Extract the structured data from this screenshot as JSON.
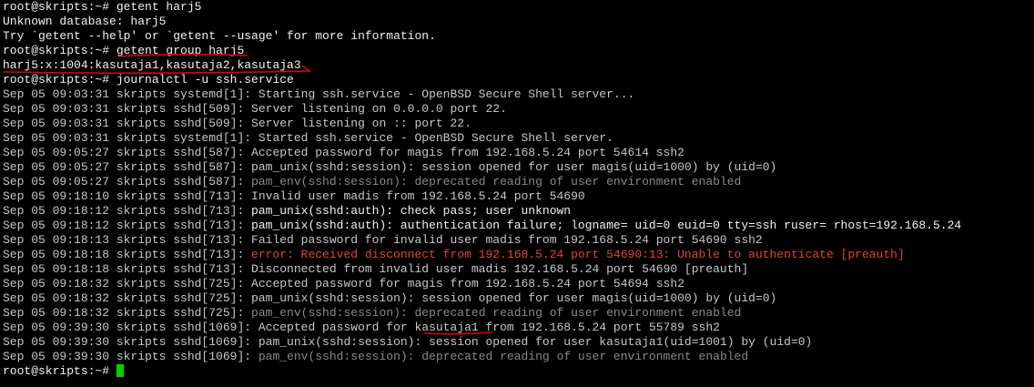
{
  "terminal": {
    "prompt": "root@skripts:~# ",
    "lines": [
      {
        "style": "bright",
        "text": "root@skripts:~# getent harj5"
      },
      {
        "style": "bright",
        "text": "Unknown database: harj5"
      },
      {
        "style": "bright",
        "text": "Try `getent --help' or `getent --usage' for more information."
      },
      {
        "style": "bright",
        "text": "root@skripts:~# getent group harj5"
      },
      {
        "style": "bright",
        "text": "harj5:x:1004:kasutaja1,kasutaja2,kasutaja3"
      },
      {
        "style": "bright",
        "text": "root@skripts:~# journalctl -u ssh.service"
      },
      {
        "style": "normal",
        "text": "Sep 05 09:03:31 skripts systemd[1]: Starting ssh.service - OpenBSD Secure Shell server..."
      },
      {
        "style": "normal",
        "text": "Sep 05 09:03:31 skripts sshd[509]: Server listening on 0.0.0.0 port 22."
      },
      {
        "style": "normal",
        "text": "Sep 05 09:03:31 skripts sshd[509]: Server listening on :: port 22."
      },
      {
        "style": "normal",
        "text": "Sep 05 09:03:31 skripts systemd[1]: Started ssh.service - OpenBSD Secure Shell server."
      },
      {
        "style": "normal",
        "text": "Sep 05 09:05:27 skripts sshd[587]: Accepted password for magis from 192.168.5.24 port 54614 ssh2"
      },
      {
        "style": "normal",
        "text": "Sep 05 09:05:27 skripts sshd[587]: pam_unix(sshd:session): session opened for user magis(uid=1000) by (uid=0)"
      },
      {
        "style": "mixed",
        "prefix": "Sep 05 09:05:27 skripts sshd[587]: ",
        "text": "pam_env(sshd:session): deprecated reading of user environment enabled"
      },
      {
        "style": "normal",
        "text": "Sep 05 09:18:10 skripts sshd[713]: Invalid user madis from 192.168.5.24 port 54690"
      },
      {
        "style": "mixed-bright",
        "prefix": "Sep 05 09:18:12 skripts sshd[713]: ",
        "text": "pam_unix(sshd:auth): check pass; user unknown"
      },
      {
        "style": "mixed-bright",
        "prefix": "Sep 05 09:18:12 skripts sshd[713]: ",
        "text": "pam_unix(sshd:auth): authentication failure; logname= uid=0 euid=0 tty=ssh ruser= rhost=192.168.5.24"
      },
      {
        "style": "normal",
        "text": "Sep 05 09:18:13 skripts sshd[713]: Failed password for invalid user madis from 192.168.5.24 port 54690 ssh2"
      },
      {
        "style": "mixed-err",
        "prefix": "Sep 05 09:18:18 skripts sshd[713]: ",
        "text": "error: Received disconnect from 192.168.5.24 port 54690:13: Unable to authenticate [preauth]"
      },
      {
        "style": "normal",
        "text": "Sep 05 09:18:18 skripts sshd[713]: Disconnected from invalid user madis 192.168.5.24 port 54690 [preauth]"
      },
      {
        "style": "normal",
        "text": "Sep 05 09:18:32 skripts sshd[725]: Accepted password for magis from 192.168.5.24 port 54694 ssh2"
      },
      {
        "style": "normal",
        "text": "Sep 05 09:18:32 skripts sshd[725]: pam_unix(sshd:session): session opened for user magis(uid=1000) by (uid=0)"
      },
      {
        "style": "mixed",
        "prefix": "Sep 05 09:18:32 skripts sshd[725]: ",
        "text": "pam_env(sshd:session): deprecated reading of user environment enabled"
      },
      {
        "style": "normal",
        "text": "Sep 05 09:39:30 skripts sshd[1069]: Accepted password for kasutaja1 from 192.168.5.24 port 55789 ssh2"
      },
      {
        "style": "normal",
        "text": "Sep 05 09:39:30 skripts sshd[1069]: pam_unix(sshd:session): session opened for user kasutaja1(uid=1001) by (uid=0)"
      },
      {
        "style": "mixed",
        "prefix": "Sep 05 09:39:30 skripts sshd[1069]: ",
        "text": "pam_env(sshd:session): deprecated reading of user environment enabled"
      }
    ]
  },
  "colors": {
    "background": "#000000",
    "text": "#c8c8c8",
    "bright_text": "#f2f2f2",
    "dim_text": "#8a8a8a",
    "error_text": "#e0453a",
    "cursor": "#00d200",
    "annotation": "#e3000f"
  }
}
